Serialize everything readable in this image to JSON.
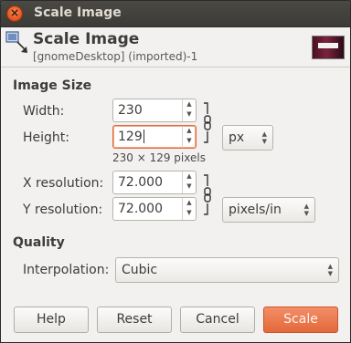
{
  "window": {
    "title": "Scale Image",
    "close_glyph": "×"
  },
  "header": {
    "title": "Scale Image",
    "subtitle": "[gnomeDesktop] (imported)-1",
    "icon": "scale-image-icon"
  },
  "image_size": {
    "section_label": "Image Size",
    "width_label": "Width:",
    "width_value": "230",
    "height_label": "Height:",
    "height_value": "129",
    "size_unit": "px",
    "pixels_info": "230 × 129 pixels",
    "xres_label": "X resolution:",
    "xres_value": "72.000",
    "yres_label": "Y resolution:",
    "yres_value": "72.000",
    "res_unit": "pixels/in"
  },
  "quality": {
    "section_label": "Quality",
    "interp_label": "Interpolation:",
    "interp_value": "Cubic"
  },
  "buttons": {
    "help": "Help",
    "reset": "Reset",
    "cancel": "Cancel",
    "scale": "Scale"
  },
  "colors": {
    "accent": "#e2693a",
    "titlebar": "#3c3b37",
    "background": "#f2f1f0"
  }
}
